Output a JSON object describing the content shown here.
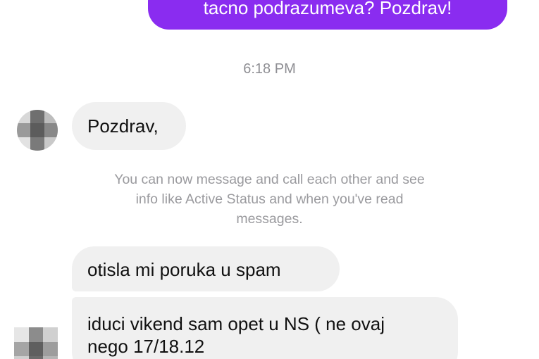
{
  "messages": {
    "outgoing_partial": "tacno podrazumeva? Pozdrav!",
    "timestamp": "6:18 PM",
    "incoming_1": "Pozdrav,",
    "system_note": {
      "line1": "You can now message and call each other and see",
      "line2": "info like Active Status and when you've read",
      "line3": "messages."
    },
    "incoming_2": "otisla mi poruka u spam",
    "incoming_3": {
      "line1": "iduci vikend sam opet u NS ( ne ovaj",
      "line2": "nego 17/18.12"
    }
  },
  "colors": {
    "outgoing_bubble": "#8a2cf0",
    "incoming_bubble": "#f0f0f0",
    "meta_text": "#8e8e93"
  },
  "icons": {
    "avatar": "blurred-avatar"
  }
}
